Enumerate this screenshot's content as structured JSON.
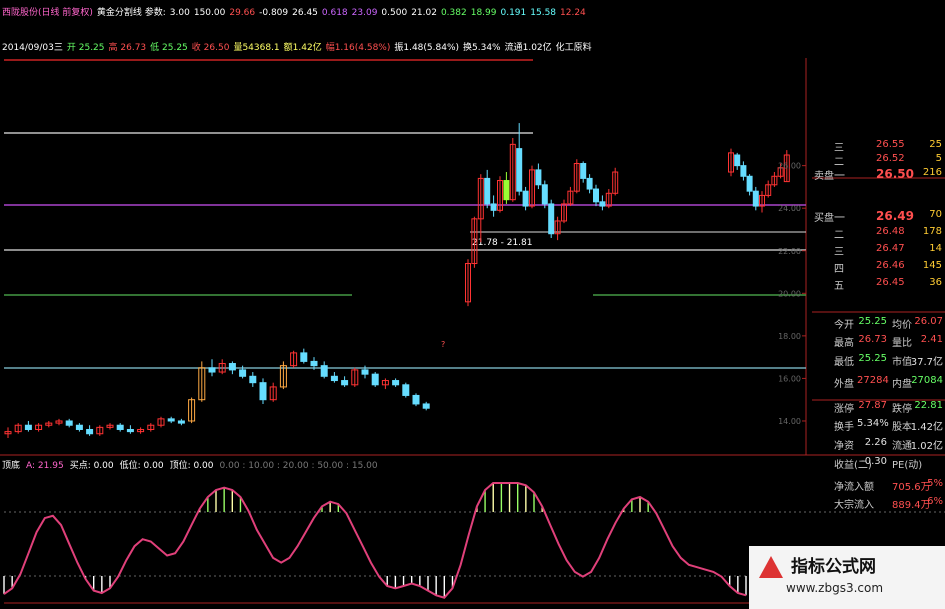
{
  "header": {
    "row1": [
      {
        "t": "西陇股份(日线 前复权)",
        "c": "#ff66cc"
      },
      {
        "t": "黄金分割线 参数:",
        "c": "#ffffff"
      },
      {
        "t": "3.00",
        "c": "#ffffff"
      },
      {
        "t": "150.00",
        "c": "#ffffff"
      },
      {
        "t": "29.66",
        "c": "#ff5050"
      },
      {
        "t": "-0.809",
        "c": "#ffffff"
      },
      {
        "t": "26.45",
        "c": "#ffffff"
      },
      {
        "t": "0.618",
        "c": "#cc66ff"
      },
      {
        "t": "23.09",
        "c": "#cc66ff"
      },
      {
        "t": "0.500",
        "c": "#ffffff"
      },
      {
        "t": "21.02",
        "c": "#ffffff"
      },
      {
        "t": "0.382",
        "c": "#66ff66"
      },
      {
        "t": "18.99",
        "c": "#66ff66"
      },
      {
        "t": "0.191",
        "c": "#66ffff"
      },
      {
        "t": "15.58",
        "c": "#66ffff"
      },
      {
        "t": "12.24",
        "c": "#ff5050"
      }
    ],
    "row2": [
      {
        "t": "2014/09/03三",
        "c": "#ffffff"
      },
      {
        "t": "开 25.25",
        "c": "#66ff66"
      },
      {
        "t": "高 26.73",
        "c": "#ff5050"
      },
      {
        "t": "低 25.25",
        "c": "#66ff66"
      },
      {
        "t": "收 26.50",
        "c": "#ff5050"
      },
      {
        "t": "量54368.1",
        "c": "#ffff66"
      },
      {
        "t": "额1.42亿",
        "c": "#ffff66"
      },
      {
        "t": "幅1.16(4.58%)",
        "c": "#ff5050"
      },
      {
        "t": "振1.48(5.84%)",
        "c": "#ffffff"
      },
      {
        "t": "换5.34%",
        "c": "#ffffff"
      },
      {
        "t": "流通1.02亿",
        "c": "#ffffff"
      },
      {
        "t": "化工原料",
        "c": "#ffffff"
      }
    ],
    "indicator": [
      {
        "t": "顶底",
        "c": "#ffffff"
      },
      {
        "t": "A: 21.95",
        "c": "#ff66cc"
      },
      {
        "t": "买点: 0.00",
        "c": "#ffffff"
      },
      {
        "t": "低位: 0.00",
        "c": "#ffffff"
      },
      {
        "t": "顶位: 0.00",
        "c": "#ffffff"
      },
      {
        "t": "0.00 : 10.00 : 20.00 : 50.00 : 15.00",
        "c": "#777777"
      }
    ]
  },
  "annotations": {
    "range_label": "21.78 - 21.81",
    "question_mark": "?"
  },
  "order_book": {
    "asks": [
      {
        "label": "三",
        "price": "26.55",
        "vol": "25"
      },
      {
        "label": "二",
        "price": "26.52",
        "vol": "5"
      },
      {
        "label": "一",
        "price": "26.50",
        "vol": "216"
      }
    ],
    "ask_title": "卖盘",
    "bid_title": "买盘",
    "bids": [
      {
        "label": "一",
        "price": "26.49",
        "vol": "70"
      },
      {
        "label": "二",
        "price": "26.48",
        "vol": "178"
      },
      {
        "label": "三",
        "price": "26.47",
        "vol": "14"
      },
      {
        "label": "四",
        "price": "26.46",
        "vol": "145"
      },
      {
        "label": "五",
        "price": "26.45",
        "vol": "36"
      }
    ]
  },
  "stats": [
    {
      "l": "今开",
      "v": "25.25",
      "vc": "#66ff66",
      "l2": "均价",
      "v2": "26.07",
      "v2c": "#ff5050"
    },
    {
      "l": "最高",
      "v": "26.73",
      "vc": "#ff5050",
      "l2": "量比",
      "v2": "2.41",
      "v2c": "#ff5050"
    },
    {
      "l": "最低",
      "v": "25.25",
      "vc": "#66ff66",
      "l2": "市值",
      "v2": "37.7亿",
      "v2c": "#e0e0e0"
    },
    {
      "l": "外盘",
      "v": "27284",
      "vc": "#ff5050",
      "l2": "内盘",
      "v2": "27084",
      "v2c": "#66ff66"
    },
    {
      "l": "涨停",
      "v": "27.87",
      "vc": "#ff5050",
      "l2": "跌停",
      "v2": "22.81",
      "v2c": "#66ff66"
    },
    {
      "l": "换手",
      "v": "5.34%",
      "vc": "#e0e0e0",
      "l2": "股本",
      "v2": "1.42亿",
      "v2c": "#e0e0e0"
    },
    {
      "l": "净资",
      "v": "2.26",
      "vc": "#e0e0e0",
      "l2": "流通",
      "v2": "1.02亿",
      "v2c": "#e0e0e0"
    },
    {
      "l": "收益(二)",
      "v": "-0.30",
      "vc": "#e0e0e0",
      "l2": "PE(动)",
      "v2": "",
      "v2c": "#e0e0e0"
    },
    {
      "l": "净流入额",
      "v": "",
      "vc": "#e0e0e0",
      "l2": "705.6万",
      "v2": "5%",
      "v2c": "#ff5050"
    },
    {
      "l": "大宗流入",
      "v": "",
      "vc": "#e0e0e0",
      "l2": "889.4万",
      "v2": "6%",
      "v2c": "#ff5050"
    }
  ],
  "watermark": {
    "title": "指标公式网",
    "url": "www.zbgs3.com"
  },
  "chart_data": {
    "type": "candlestick",
    "price_axis": {
      "ticks": [
        "26.00",
        "24.00",
        "22.00",
        "20.00",
        "18.00",
        "16.00",
        "14.00"
      ]
    },
    "gold_lines": {
      "price_line": 26.45,
      "golden_0618": 23.09,
      "half_0500": 21.02,
      "level_0382": 18.99,
      "level_0191": 15.58
    },
    "up_color": "#ff3333",
    "down_color": "#66ddff",
    "candles": [
      {
        "o": 13.4,
        "h": 13.7,
        "l": 13.2,
        "c": 13.5
      },
      {
        "o": 13.5,
        "h": 13.9,
        "l": 13.4,
        "c": 13.8
      },
      {
        "o": 13.8,
        "h": 14.0,
        "l": 13.5,
        "c": 13.6
      },
      {
        "o": 13.6,
        "h": 13.9,
        "l": 13.5,
        "c": 13.8
      },
      {
        "o": 13.8,
        "h": 14.0,
        "l": 13.7,
        "c": 13.9
      },
      {
        "o": 13.9,
        "h": 14.1,
        "l": 13.8,
        "c": 14.0
      },
      {
        "o": 14.0,
        "h": 14.1,
        "l": 13.7,
        "c": 13.8
      },
      {
        "o": 13.8,
        "h": 13.9,
        "l": 13.5,
        "c": 13.6
      },
      {
        "o": 13.6,
        "h": 13.8,
        "l": 13.3,
        "c": 13.4
      },
      {
        "o": 13.4,
        "h": 13.8,
        "l": 13.3,
        "c": 13.7
      },
      {
        "o": 13.7,
        "h": 13.9,
        "l": 13.6,
        "c": 13.8
      },
      {
        "o": 13.8,
        "h": 13.9,
        "l": 13.5,
        "c": 13.6
      },
      {
        "o": 13.6,
        "h": 13.8,
        "l": 13.4,
        "c": 13.5
      },
      {
        "o": 13.5,
        "h": 13.7,
        "l": 13.4,
        "c": 13.6
      },
      {
        "o": 13.6,
        "h": 13.9,
        "l": 13.5,
        "c": 13.8
      },
      {
        "o": 13.8,
        "h": 14.2,
        "l": 13.7,
        "c": 14.1
      },
      {
        "o": 14.1,
        "h": 14.2,
        "l": 13.9,
        "c": 14.0
      },
      {
        "o": 14.0,
        "h": 14.1,
        "l": 13.8,
        "c": 13.9
      },
      {
        "o": 14.0,
        "h": 15.1,
        "l": 13.9,
        "c": 15.0
      },
      {
        "o": 15.0,
        "h": 16.8,
        "l": 14.9,
        "c": 16.5
      },
      {
        "o": 16.5,
        "h": 16.9,
        "l": 16.1,
        "c": 16.3
      },
      {
        "o": 16.3,
        "h": 16.9,
        "l": 16.2,
        "c": 16.7
      },
      {
        "o": 16.7,
        "h": 16.8,
        "l": 16.2,
        "c": 16.4
      },
      {
        "o": 16.4,
        "h": 16.6,
        "l": 16.0,
        "c": 16.1
      },
      {
        "o": 16.1,
        "h": 16.3,
        "l": 15.6,
        "c": 15.8
      },
      {
        "o": 15.8,
        "h": 16.0,
        "l": 14.8,
        "c": 15.0
      },
      {
        "o": 15.0,
        "h": 15.8,
        "l": 14.9,
        "c": 15.6
      },
      {
        "o": 15.6,
        "h": 16.8,
        "l": 15.5,
        "c": 16.6
      },
      {
        "o": 16.6,
        "h": 17.3,
        "l": 16.5,
        "c": 17.2
      },
      {
        "o": 17.2,
        "h": 17.4,
        "l": 16.7,
        "c": 16.8
      },
      {
        "o": 16.8,
        "h": 17.0,
        "l": 16.4,
        "c": 16.6
      },
      {
        "o": 16.6,
        "h": 16.8,
        "l": 16.0,
        "c": 16.1
      },
      {
        "o": 16.1,
        "h": 16.3,
        "l": 15.8,
        "c": 15.9
      },
      {
        "o": 15.9,
        "h": 16.1,
        "l": 15.6,
        "c": 15.7
      },
      {
        "o": 15.7,
        "h": 16.5,
        "l": 15.6,
        "c": 16.4
      },
      {
        "o": 16.4,
        "h": 16.6,
        "l": 16.0,
        "c": 16.2
      },
      {
        "o": 16.2,
        "h": 16.3,
        "l": 15.6,
        "c": 15.7
      },
      {
        "o": 15.7,
        "h": 16.0,
        "l": 15.5,
        "c": 15.9
      },
      {
        "o": 15.9,
        "h": 16.0,
        "l": 15.6,
        "c": 15.7
      },
      {
        "o": 15.7,
        "h": 15.8,
        "l": 15.1,
        "c": 15.2
      },
      {
        "o": 15.2,
        "h": 15.3,
        "l": 14.7,
        "c": 14.8
      },
      {
        "o": 14.8,
        "h": 14.9,
        "l": 14.5,
        "c": 14.6
      },
      {
        "o": 19.6,
        "h": 21.6,
        "l": 19.4,
        "c": 21.4
      },
      {
        "o": 21.4,
        "h": 23.6,
        "l": 21.2,
        "c": 23.5
      },
      {
        "o": 23.5,
        "h": 25.6,
        "l": 22.4,
        "c": 25.4
      },
      {
        "o": 25.4,
        "h": 25.8,
        "l": 24.0,
        "c": 24.2
      },
      {
        "o": 24.2,
        "h": 24.6,
        "l": 23.6,
        "c": 23.9
      },
      {
        "o": 23.9,
        "h": 25.5,
        "l": 23.8,
        "c": 25.3
      },
      {
        "o": 25.3,
        "h": 25.7,
        "l": 24.2,
        "c": 24.4
      },
      {
        "o": 24.4,
        "h": 27.3,
        "l": 24.3,
        "c": 27.0
      },
      {
        "o": 26.8,
        "h": 28.0,
        "l": 24.6,
        "c": 24.8
      },
      {
        "o": 24.8,
        "h": 25.0,
        "l": 23.9,
        "c": 24.1
      },
      {
        "o": 24.1,
        "h": 26.0,
        "l": 24.0,
        "c": 25.8
      },
      {
        "o": 25.8,
        "h": 26.1,
        "l": 24.9,
        "c": 25.1
      },
      {
        "o": 25.1,
        "h": 25.3,
        "l": 24.0,
        "c": 24.2
      },
      {
        "o": 24.2,
        "h": 24.4,
        "l": 22.6,
        "c": 22.8
      },
      {
        "o": 22.8,
        "h": 23.6,
        "l": 22.5,
        "c": 23.4
      },
      {
        "o": 23.4,
        "h": 24.4,
        "l": 23.3,
        "c": 24.2
      },
      {
        "o": 24.2,
        "h": 25.0,
        "l": 24.1,
        "c": 24.8
      },
      {
        "o": 24.8,
        "h": 26.3,
        "l": 24.7,
        "c": 26.1
      },
      {
        "o": 26.1,
        "h": 26.2,
        "l": 25.2,
        "c": 25.4
      },
      {
        "o": 25.4,
        "h": 25.6,
        "l": 24.7,
        "c": 24.9
      },
      {
        "o": 24.9,
        "h": 25.1,
        "l": 24.1,
        "c": 24.3
      },
      {
        "o": 24.3,
        "h": 24.6,
        "l": 23.9,
        "c": 24.1
      },
      {
        "o": 24.1,
        "h": 24.9,
        "l": 24.0,
        "c": 24.7
      },
      {
        "o": 24.7,
        "h": 25.9,
        "l": 24.6,
        "c": 25.7
      },
      {
        "o": 25.7,
        "h": 26.8,
        "l": 25.5,
        "c": 26.6
      },
      {
        "o": 26.5,
        "h": 26.6,
        "l": 25.8,
        "c": 26.0
      },
      {
        "o": 26.0,
        "h": 26.2,
        "l": 25.3,
        "c": 25.5
      },
      {
        "o": 25.5,
        "h": 25.6,
        "l": 24.6,
        "c": 24.8
      },
      {
        "o": 24.8,
        "h": 25.0,
        "l": 23.9,
        "c": 24.1
      },
      {
        "o": 24.1,
        "h": 24.8,
        "l": 23.8,
        "c": 24.6
      },
      {
        "o": 24.6,
        "h": 25.3,
        "l": 24.5,
        "c": 25.1
      },
      {
        "o": 25.1,
        "h": 25.7,
        "l": 25.0,
        "c": 25.5
      },
      {
        "o": 25.5,
        "h": 26.1,
        "l": 25.4,
        "c": 25.9
      },
      {
        "o": 25.25,
        "h": 26.73,
        "l": 25.25,
        "c": 26.5
      }
    ],
    "indicator_A": [
      5,
      10,
      22,
      40,
      58,
      70,
      72,
      64,
      48,
      32,
      18,
      8,
      6,
      10,
      20,
      34,
      46,
      52,
      50,
      44,
      38,
      40,
      50,
      64,
      78,
      88,
      94,
      96,
      94,
      88,
      76,
      60,
      48,
      36,
      32,
      36,
      46,
      58,
      70,
      80,
      84,
      82,
      74,
      60,
      46,
      32,
      20,
      12,
      10,
      12,
      14,
      12,
      8,
      4,
      2,
      10,
      30,
      56,
      80,
      94,
      100,
      100,
      100,
      100,
      98,
      92,
      80,
      64,
      48,
      34,
      24,
      20,
      24,
      36,
      52,
      66,
      78,
      86,
      88,
      84,
      74,
      60,
      46,
      36,
      30,
      28,
      26,
      24,
      20,
      12,
      6,
      4
    ]
  }
}
